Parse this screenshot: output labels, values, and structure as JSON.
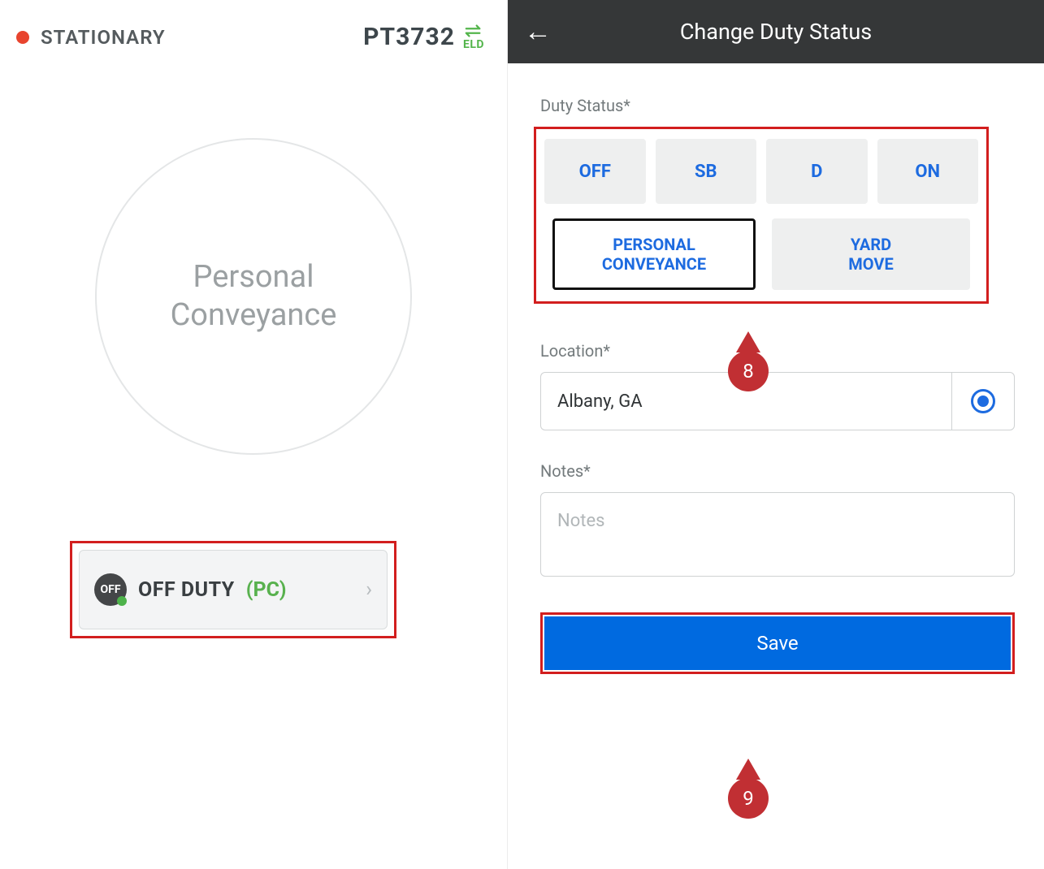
{
  "left": {
    "vehicle_status": "STATIONARY",
    "vehicle_id": "PT3732",
    "eld_label": "ELD",
    "circle_text": "Personal\nConveyance",
    "off_badge_text": "OFF",
    "off_duty_label": "OFF DUTY ",
    "pc_label": "(PC)"
  },
  "right": {
    "header_title": "Change Duty Status",
    "duty_status_label": "Duty Status*",
    "duty_status_options": {
      "off": "OFF",
      "sb": "SB",
      "d": "D",
      "on": "ON",
      "personal_conveyance": "PERSONAL\nCONVEYANCE",
      "yard_move": "YARD\nMOVE"
    },
    "selected_option": "personal_conveyance",
    "location_label": "Location*",
    "location_value": "Albany, GA",
    "notes_label": "Notes*",
    "notes_placeholder": "Notes",
    "save_label": "Save"
  },
  "annotations": {
    "pin8": "8",
    "pin9": "9"
  },
  "colors": {
    "accent_blue": "#006ae0",
    "text_blue": "#1d6be0",
    "highlight_red": "#d21e1e",
    "pin_red": "#c12f33",
    "green": "#53b54b"
  }
}
